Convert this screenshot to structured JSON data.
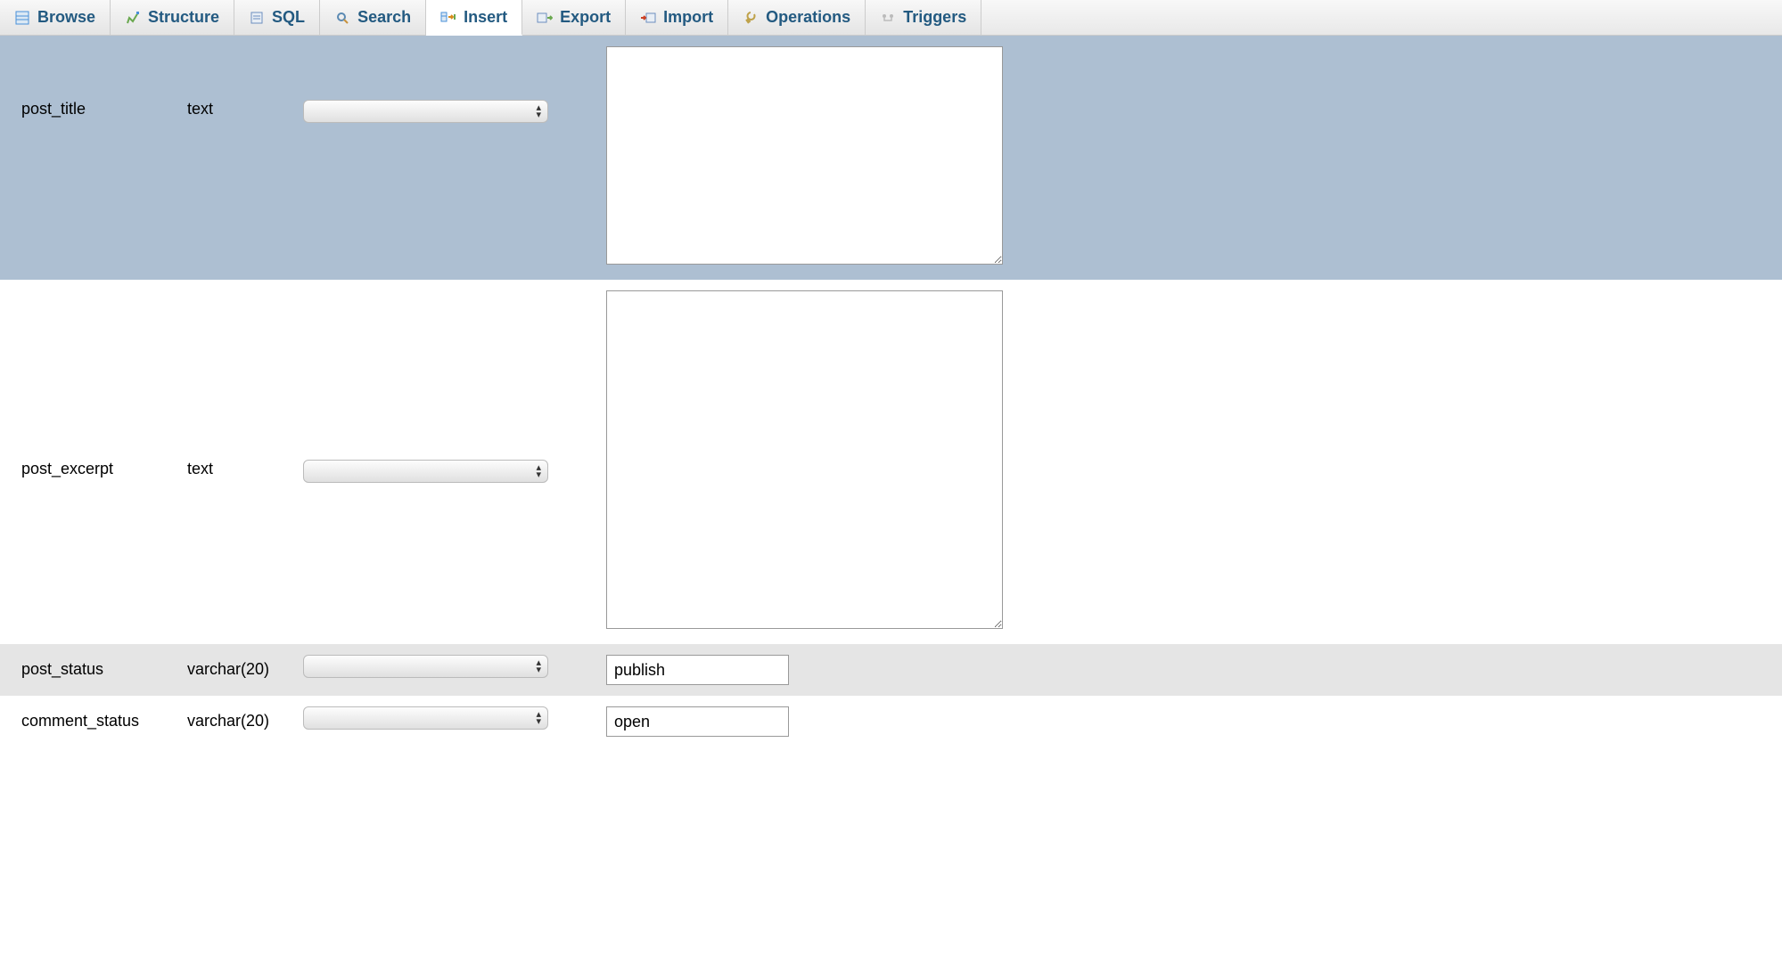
{
  "tabs": [
    {
      "label": "Browse",
      "icon": "browse-icon",
      "active": false
    },
    {
      "label": "Structure",
      "icon": "structure-icon",
      "active": false
    },
    {
      "label": "SQL",
      "icon": "sql-icon",
      "active": false
    },
    {
      "label": "Search",
      "icon": "search-icon",
      "active": false
    },
    {
      "label": "Insert",
      "icon": "insert-icon",
      "active": true
    },
    {
      "label": "Export",
      "icon": "export-icon",
      "active": false
    },
    {
      "label": "Import",
      "icon": "import-icon",
      "active": false
    },
    {
      "label": "Operations",
      "icon": "operations-icon",
      "active": false
    },
    {
      "label": "Triggers",
      "icon": "triggers-icon",
      "active": false
    }
  ],
  "rows": [
    {
      "name": "post_title",
      "type": "text",
      "function": "",
      "value": "",
      "input": "textarea",
      "bg": "blue"
    },
    {
      "name": "post_excerpt",
      "type": "text",
      "function": "",
      "value": "",
      "input": "textarea",
      "bg": "white"
    },
    {
      "name": "post_status",
      "type": "varchar(20)",
      "function": "",
      "value": "publish",
      "input": "text",
      "bg": "grey"
    },
    {
      "name": "comment_status",
      "type": "varchar(20)",
      "function": "",
      "value": "open",
      "input": "text",
      "bg": "white"
    }
  ]
}
